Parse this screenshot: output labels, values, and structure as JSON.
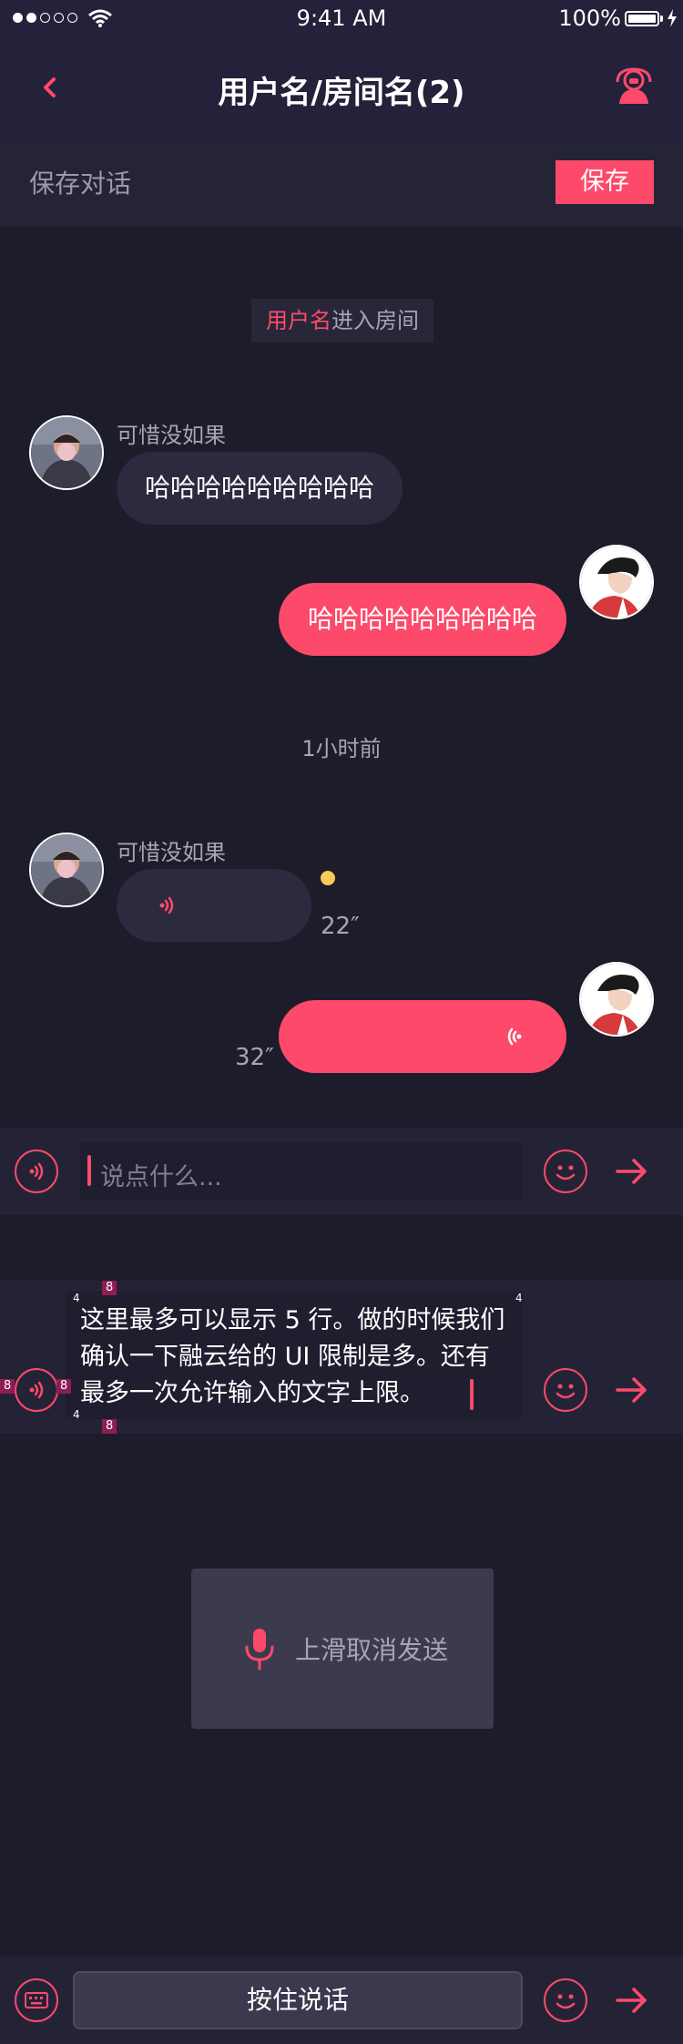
{
  "status_bar": {
    "time": "9:41 AM",
    "battery": "100%"
  },
  "nav": {
    "title": "用户名/房间名(2)"
  },
  "save_row": {
    "label": "保存对话",
    "button": "保存"
  },
  "system_notice": {
    "name": "用户名",
    "text": "进入房间"
  },
  "messages": [
    {
      "sender": "可惜没如果",
      "text": "哈哈哈哈哈哈哈哈哈"
    },
    {
      "text": "哈哈哈哈哈哈哈哈哈"
    }
  ],
  "time_divider": "1小时前",
  "voice_messages": [
    {
      "sender": "可惜没如果",
      "duration": "22″"
    },
    {
      "duration": "32″"
    }
  ],
  "input": {
    "placeholder": "说点什么..."
  },
  "input_expanded": {
    "text": "这里最多可以显示 5 行。做的时候我们确认一下融云给的 UI 限制是多。还有最多一次允许输入的文字上限。",
    "spacing_marks": [
      "8",
      "4",
      "4",
      "8",
      "8",
      "4",
      "8"
    ]
  },
  "recording": {
    "label": "上滑取消发送"
  },
  "bottom_bar": {
    "hold_to_talk": "按住说话"
  },
  "colors": {
    "accent": "#fd4a6b",
    "background": "#1d1c2b",
    "bar": "#242336"
  },
  "icons": [
    "back-icon",
    "user-icon",
    "voice-icon",
    "emoji-icon",
    "send-icon",
    "mic-icon",
    "keyboard-icon"
  ]
}
